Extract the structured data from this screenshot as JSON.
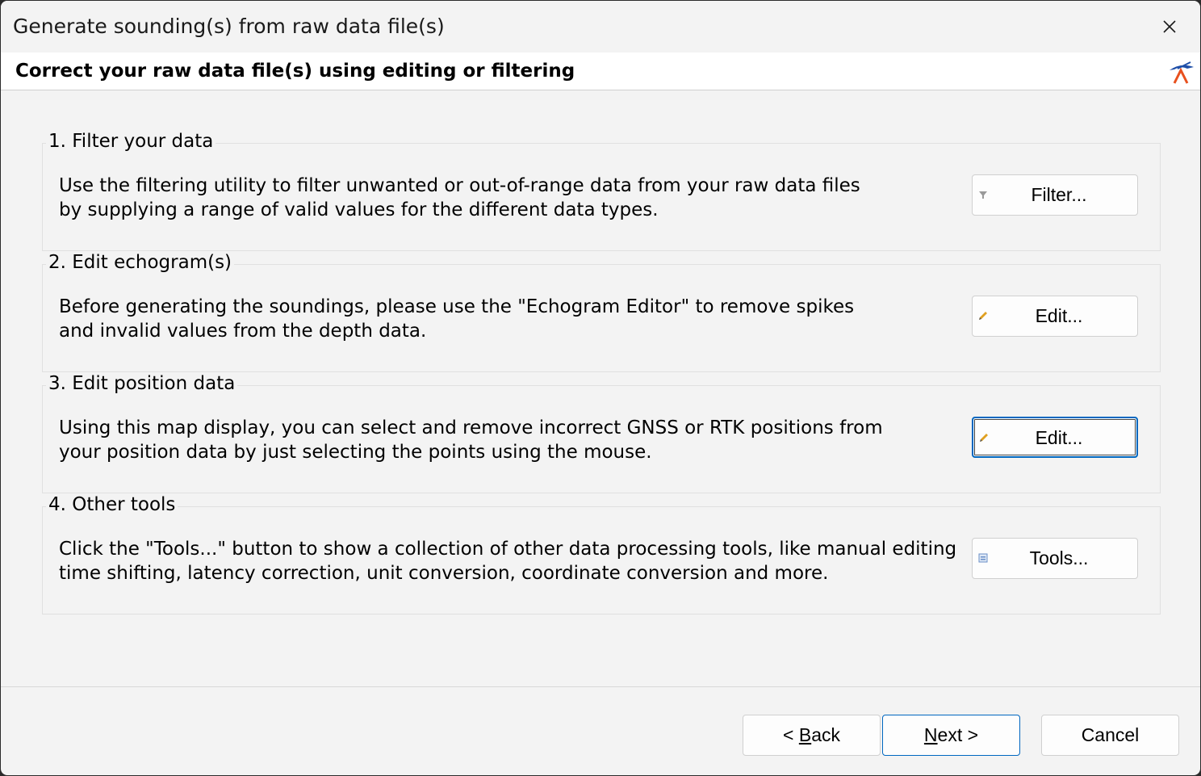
{
  "window": {
    "title": "Generate sounding(s) from raw data file(s)"
  },
  "header": {
    "title": "Correct your raw data file(s) using editing or filtering"
  },
  "groups": [
    {
      "title": "1. Filter your data",
      "desc_line1": "Use the filtering utility to filter unwanted or out-of-range data from your raw data files",
      "desc_line2": "by supplying a range of valid values for the different data types.",
      "button_label": "Filter...",
      "button_icon": "filter-icon"
    },
    {
      "title": "2. Edit echogram(s)",
      "desc_line1": "Before generating the soundings, please use the \"Echogram Editor\" to remove spikes",
      "desc_line2": "and invalid values from the depth data.",
      "button_label": "Edit...",
      "button_icon": "pencil-icon"
    },
    {
      "title": "3. Edit position data",
      "desc_line1": "Using this map display, you can select and remove incorrect GNSS or RTK positions from",
      "desc_line2": "your position data by just selecting the points using the mouse.",
      "button_label": "Edit...",
      "button_icon": "pencil-icon"
    },
    {
      "title": "4. Other tools",
      "desc_line1": "Click the \"Tools...\" button to show a collection of other data processing tools, like manual editing",
      "desc_line2": "time shifting, latency correction, unit conversion, coordinate conversion and more.",
      "button_label": "Tools...",
      "button_icon": "tools-icon"
    }
  ],
  "footer": {
    "back_prefix": "< ",
    "back_mnemonic": "B",
    "back_rest": "ack",
    "next_mnemonic": "N",
    "next_rest": "ext >",
    "cancel_label": "Cancel"
  },
  "colors": {
    "window_bg": "#f3f3f3",
    "header_bg": "#ffffff",
    "focus_accent": "#0067c0"
  }
}
